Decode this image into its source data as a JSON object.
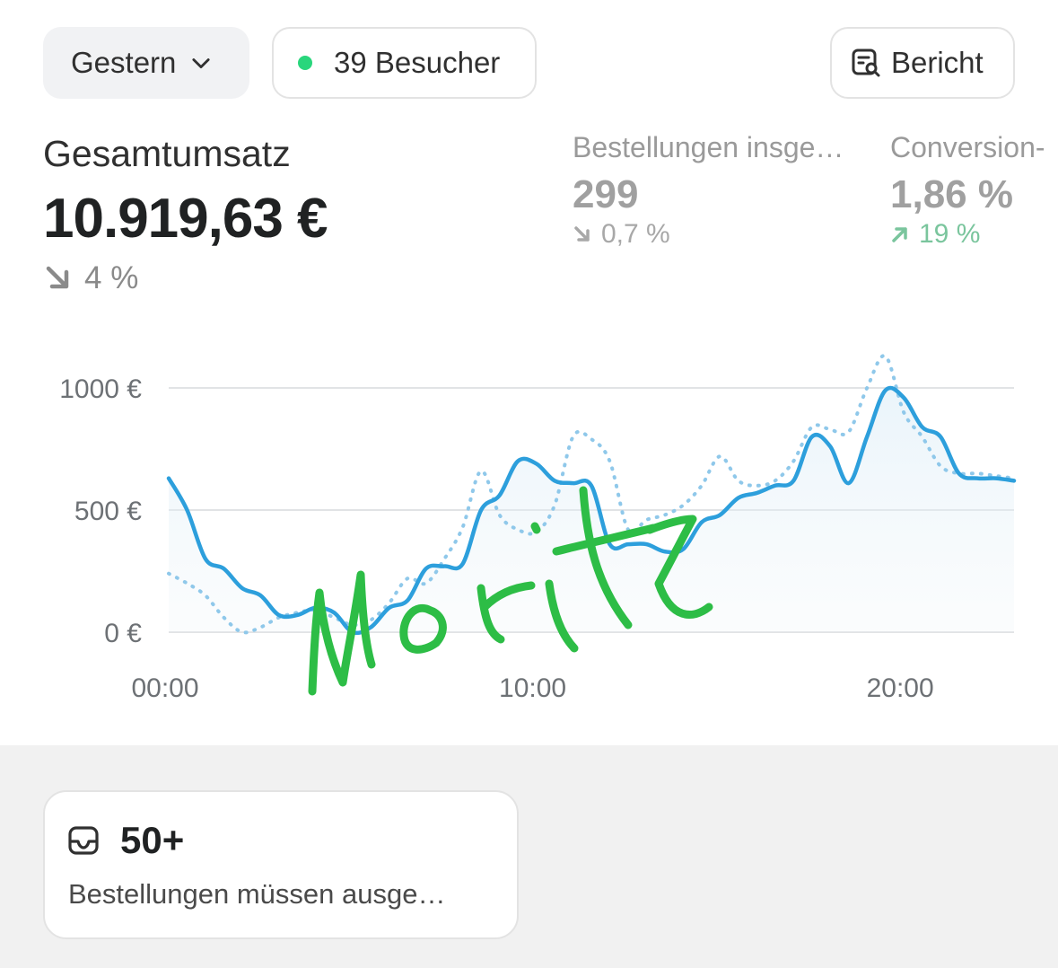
{
  "toolbar": {
    "date_label": "Gestern",
    "visitors_label": "39 Besucher",
    "report_label": "Bericht"
  },
  "metrics": {
    "main": {
      "label": "Gesamtumsatz",
      "value": "10.919,63 €",
      "delta": "4 %"
    },
    "orders": {
      "label": "Bestellungen insge…",
      "value": "299",
      "delta": "0,7 %"
    },
    "conversion": {
      "label": "Conversion-",
      "value": "1,86 %",
      "delta": "19 %"
    }
  },
  "colors": {
    "primary_line": "#2d9fdc",
    "comparison_line": "#8fc8ea",
    "visitor_dot": "#29d67c",
    "positive": "#7ac59d",
    "annotation": "#2dbd46"
  },
  "chart_data": {
    "type": "line",
    "y_ticks": [
      "1000 €",
      "500 €",
      "0 €"
    ],
    "x_ticks": [
      "00:00",
      "10:00",
      "20:00"
    ],
    "ylim": [
      0,
      1000
    ],
    "xlim": [
      0,
      23
    ],
    "series": [
      {
        "style": "solid",
        "x": [
          0,
          0.5,
          1,
          1.5,
          2,
          2.5,
          3,
          3.5,
          4,
          4.5,
          5,
          5.5,
          6,
          6.5,
          7,
          7.5,
          8,
          8.5,
          9,
          9.5,
          10,
          10.5,
          11,
          11.5,
          12,
          12.5,
          13,
          13.5,
          14,
          14.5,
          15,
          15.5,
          16,
          16.5,
          17,
          17.5,
          18,
          18.5,
          19,
          19.5,
          20,
          20.5,
          21,
          21.5,
          22,
          22.5,
          23
        ],
        "values": [
          630,
          500,
          300,
          260,
          180,
          150,
          70,
          70,
          100,
          80,
          0,
          20,
          100,
          130,
          260,
          270,
          280,
          500,
          560,
          700,
          690,
          620,
          610,
          600,
          360,
          360,
          360,
          330,
          340,
          450,
          480,
          550,
          570,
          600,
          620,
          800,
          760,
          610,
          800,
          990,
          960,
          840,
          800,
          650,
          630,
          630,
          620
        ]
      },
      {
        "style": "dotted",
        "x": [
          0,
          0.5,
          1,
          1.5,
          2,
          2.5,
          3,
          3.5,
          4,
          4.5,
          5,
          5.5,
          6,
          6.5,
          7,
          7.5,
          8,
          8.5,
          9,
          9.5,
          10,
          10.5,
          11,
          11.5,
          12,
          12.5,
          13,
          13.5,
          14,
          14.5,
          15,
          15.5,
          16,
          16.5,
          17,
          17.5,
          18,
          18.5,
          19,
          19.5,
          20,
          20.5,
          21,
          21.5,
          22,
          22.5,
          23
        ],
        "values": [
          240,
          200,
          150,
          60,
          0,
          20,
          60,
          80,
          90,
          60,
          30,
          50,
          120,
          220,
          200,
          300,
          430,
          660,
          480,
          420,
          410,
          520,
          800,
          790,
          700,
          420,
          460,
          480,
          520,
          600,
          720,
          620,
          600,
          620,
          700,
          840,
          830,
          820,
          1000,
          1130,
          900,
          800,
          680,
          650,
          650,
          640,
          630
        ]
      }
    ]
  },
  "card": {
    "count": "50+",
    "text": "Bestellungen müssen ausge…"
  }
}
